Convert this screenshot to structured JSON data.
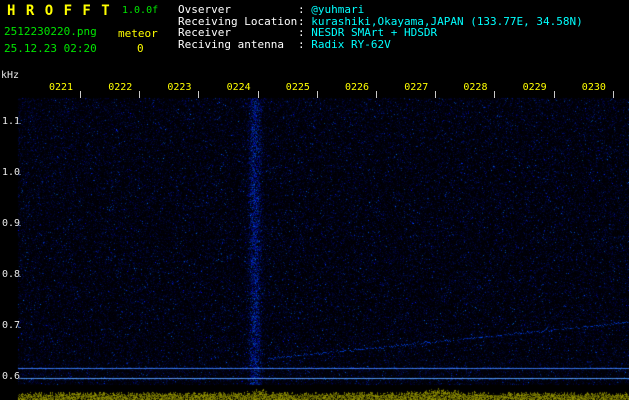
{
  "header": {
    "title": "H R O F F T",
    "version": "1.0.0f",
    "filename": "2512230220.png",
    "datetime": "25.12.23 02:20",
    "meteor_label": "meteor",
    "meteor_count": "0",
    "info": [
      {
        "label": "Ovserver",
        "value": "@yuhmari"
      },
      {
        "label": "Receiving Location",
        "value": "kurashiki,Okayama,JAPAN (133.77E, 34.58N)"
      },
      {
        "label": "Receiver",
        "value": "NESDR SMArt + HDSDR"
      },
      {
        "label": "Reciving antenna",
        "value": "Radix RY-62V"
      }
    ]
  },
  "colors": {
    "accent_yellow": "#ffff00",
    "text_green": "#00e600",
    "text_cyan": "#00ffff",
    "text_white": "#f0f0f0",
    "noise_blue": "#2238cc",
    "carrier_blue": "#6f9bff",
    "level_olive": "#8a8a00",
    "background": "#000000"
  },
  "chart_data": {
    "type": "heatmap",
    "x_axis": {
      "tick_labels": [
        "0221",
        "0222",
        "0223",
        "0224",
        "0225",
        "0226",
        "0227",
        "0228",
        "0229",
        "0230"
      ]
    },
    "y_axis": {
      "unit_label": "kHz",
      "tick_labels": [
        "1.1",
        "1.0",
        "0.9",
        "0.8",
        "0.7",
        "0.6"
      ],
      "range_khz": [
        0.56,
        1.16
      ]
    },
    "features": {
      "carrier_lines_khz": [
        0.62,
        0.6
      ],
      "vertical_burst_time": "0224",
      "drifting_trace": {
        "start_time": "0224",
        "start_khz": 0.64,
        "end_time": "0230",
        "end_khz": 0.71
      },
      "level_strip_spike_times": [
        "0224",
        "0227"
      ]
    }
  }
}
